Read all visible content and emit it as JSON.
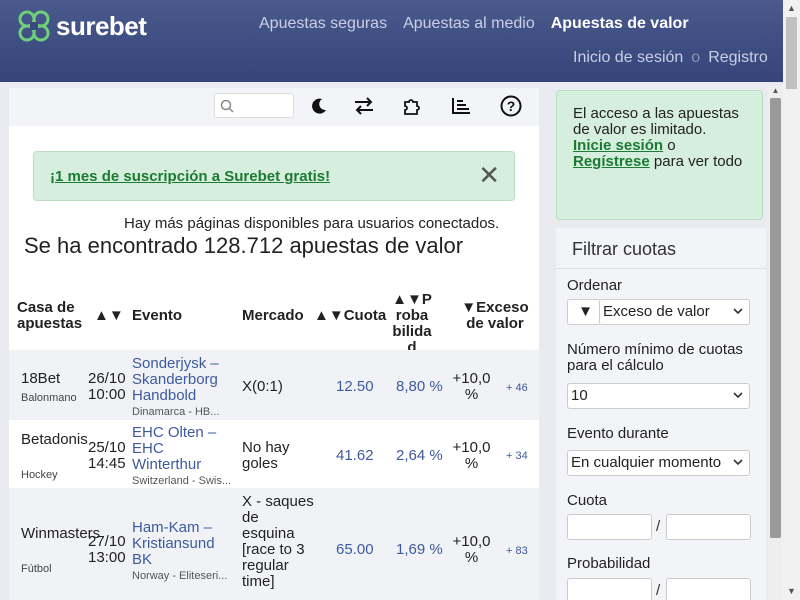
{
  "brand": {
    "name": "surebet"
  },
  "nav": {
    "items": [
      "Apuestas seguras",
      "Apuestas al medio",
      "Apuestas de valor"
    ],
    "active": "Apuestas de valor"
  },
  "auth": {
    "login": "Inicio de sesión",
    "sep": "o",
    "register": "Registro"
  },
  "toolbar": {
    "icons": [
      "search-icon",
      "moon-icon",
      "swap-icon",
      "puzzle-icon",
      "chart-icon",
      "help-icon"
    ]
  },
  "promo": {
    "text": "¡1 mes de suscripción a Surebet gratis!",
    "close": "✕"
  },
  "more_pages": "Hay más páginas disponibles para usuarios conectados.",
  "found": "Se ha encontrado 128.712 apuestas de valor",
  "columns": {
    "bookmaker": "Casa de apuestas",
    "sort": "▲▼",
    "event": "Evento",
    "market": "Mercado",
    "odds": "▲▼Cuota",
    "prob": "▲▼Probabilidad",
    "excess": "▼Exceso de valor"
  },
  "rows": [
    {
      "bookmaker": "18Bet",
      "sport": "Balonmano",
      "date": "26/10",
      "time": "10:00",
      "event": "Sonderjysk – Skanderborg Handbold",
      "league": "Dinamarca - HB...",
      "market": "X(0:1)",
      "odds": "12.50",
      "prob": "8,80 %",
      "excess": "+10,0 %",
      "more": "+ 46"
    },
    {
      "bookmaker": "Betadonis",
      "sport": "Hockey",
      "date": "25/10",
      "time": "14:45",
      "event": "EHC Olten – EHC Winterthur",
      "league": "Switzerland - Swis...",
      "market": "No hay goles",
      "odds": "41.62",
      "prob": "2,64 %",
      "excess": "+10,0 %",
      "more": "+ 34"
    },
    {
      "bookmaker": "Winmasters",
      "sport": "Fútbol",
      "date": "27/10",
      "time": "13:00",
      "event": "Ham-Kam – Kristiansund BK",
      "league": "Norway - Eliteseri...",
      "market": "X - saques de esquina [race to 3 regular time]",
      "odds": "65.00",
      "prob": "1,69 %",
      "excess": "+10,0 %",
      "more": "+ 83"
    }
  ],
  "sidebar": {
    "notice": {
      "text1": "El acceso a las apuestas de valor es limitado.",
      "login": "Inicie sesión",
      "or": "o",
      "register": "Regístrese",
      "text2": "para ver todo"
    },
    "filter": {
      "title": "Filtrar cuotas",
      "order_label": "Ordenar",
      "order_dir": "▼",
      "order_value": "Exceso de valor",
      "min_label": "Número mínimo de cuotas para el cálculo",
      "min_value": "10",
      "during_label": "Evento durante",
      "during_value": "En cualquier momento",
      "odds_label": "Cuota",
      "prob_label": "Probabilidad",
      "range_sep": "/"
    }
  }
}
